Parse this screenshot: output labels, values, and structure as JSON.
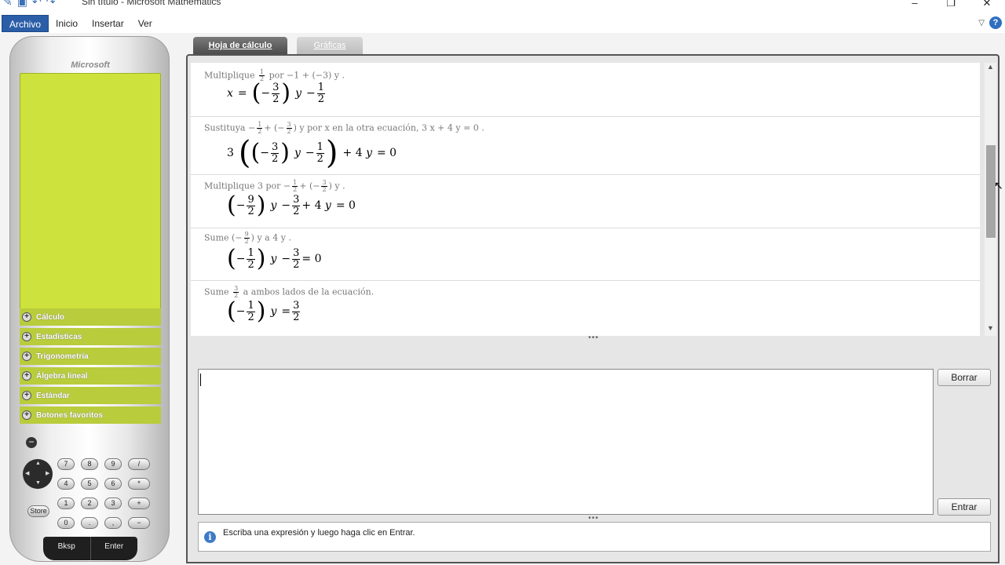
{
  "window": {
    "title": "Sin título - Microsoft Mathematics",
    "controls": {
      "minimize": "–",
      "restore": "❐",
      "close": "✕"
    }
  },
  "menu": {
    "items": [
      "Archivo",
      "Inicio",
      "Insertar",
      "Ver"
    ],
    "active": "Archivo",
    "help": "?"
  },
  "calculator": {
    "brand": "Microsoft",
    "categories": [
      "Cálculo",
      "Estadísticas",
      "Trigonometría",
      "Álgebra lineal",
      "Estándar",
      "Botones favoritos"
    ],
    "keys_row1": [
      "7",
      "8",
      "9",
      "/"
    ],
    "keys_row2": [
      "4",
      "5",
      "6",
      "*"
    ],
    "keys_row3": [
      "1",
      "2",
      "3",
      "+"
    ],
    "keys_row4": [
      "0",
      ".",
      ",",
      "−"
    ],
    "store": "Store",
    "bksp": "Bksp",
    "enter": "Enter",
    "screen_color": "#cde23c"
  },
  "tabs": {
    "worksheet": "Hoja de cálculo",
    "graphs": "Gráficas"
  },
  "steps": {
    "s1": {
      "desc_a": "Multiplique",
      "desc_b": "por −1 + (−3) y ."
    },
    "s2": {
      "desc_a": "Sustituya",
      "desc_b": "y  por  x  en la otra ecuación,  3 x + 4 y = 0 ."
    },
    "s3": {
      "desc_a": "Multiplique  3  por",
      "desc_b": "y ."
    },
    "s4": {
      "desc_a": "Sume",
      "desc_b": "y  a  4 y ."
    },
    "s5": {
      "desc_b": "a ambos lados de la ecuación."
    }
  },
  "input": {
    "value": "",
    "clear_button": "Borrar",
    "enter_button": "Entrar"
  },
  "status": {
    "message": "Escriba una expresión y luego haga clic en Entrar."
  }
}
